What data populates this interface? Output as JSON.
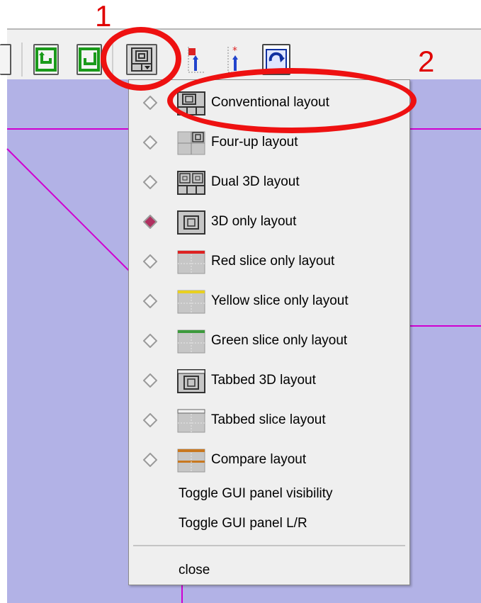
{
  "callouts": {
    "first": "1",
    "second": "2"
  },
  "toolbar": {
    "buttons": [
      {
        "name": "partial-button",
        "icon": "box-icon"
      },
      {
        "name": "undo-button",
        "icon": "undo-icon"
      },
      {
        "name": "redo-button",
        "icon": "redo-icon"
      },
      {
        "name": "layout-menu-button",
        "icon": "layout-icon"
      },
      {
        "name": "fiducial-place-button",
        "icon": "fiducial-arrow-icon"
      },
      {
        "name": "fiducial-star-button",
        "icon": "fiducial-star-icon"
      },
      {
        "name": "refresh-button",
        "icon": "refresh-icon"
      }
    ]
  },
  "menu": {
    "items": [
      {
        "label": "Conventional layout",
        "selected": false,
        "icon": "conventional-layout-icon"
      },
      {
        "label": "Four-up layout",
        "selected": false,
        "icon": "four-up-layout-icon"
      },
      {
        "label": "Dual 3D layout",
        "selected": false,
        "icon": "dual-3d-layout-icon"
      },
      {
        "label": "3D only layout",
        "selected": true,
        "icon": "3d-only-layout-icon"
      },
      {
        "label": "Red slice only layout",
        "selected": false,
        "icon": "red-slice-layout-icon",
        "accent": "#dd2222"
      },
      {
        "label": "Yellow slice only layout",
        "selected": false,
        "icon": "yellow-slice-layout-icon",
        "accent": "#e8d020"
      },
      {
        "label": "Green slice only layout",
        "selected": false,
        "icon": "green-slice-layout-icon",
        "accent": "#3c9a3c"
      },
      {
        "label": "Tabbed 3D layout",
        "selected": false,
        "icon": "tabbed-3d-layout-icon"
      },
      {
        "label": "Tabbed slice layout",
        "selected": false,
        "icon": "tabbed-slice-layout-icon"
      },
      {
        "label": "Compare layout",
        "selected": false,
        "icon": "compare-layout-icon",
        "accent": "#c87820"
      }
    ],
    "toggle_visibility": "Toggle GUI panel visibility",
    "toggle_lr": "Toggle GUI panel L/R",
    "close": "close"
  },
  "colors": {
    "viewport_bg": "#b2b2e6",
    "slice_line": "#d000d0",
    "annotation": "#ee1111",
    "selected_radio": "#b03060"
  }
}
